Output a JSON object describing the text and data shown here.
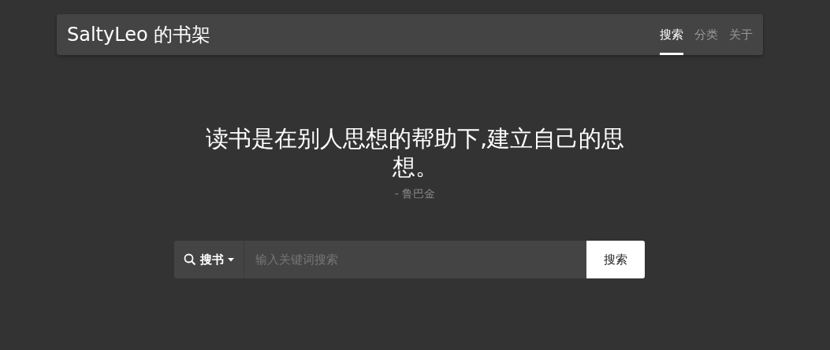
{
  "header": {
    "title": "SaltyLeo 的书架",
    "nav": [
      {
        "label": "搜索",
        "selected": true
      },
      {
        "label": "分类",
        "selected": false
      },
      {
        "label": "关于",
        "selected": false
      }
    ]
  },
  "quote": {
    "text": "读书是在别人思想的帮助下,建立自己的思想。",
    "author": "- 鲁巴金"
  },
  "search": {
    "scope": "搜书",
    "placeholder": "输入关键词搜索",
    "button": "搜索"
  }
}
